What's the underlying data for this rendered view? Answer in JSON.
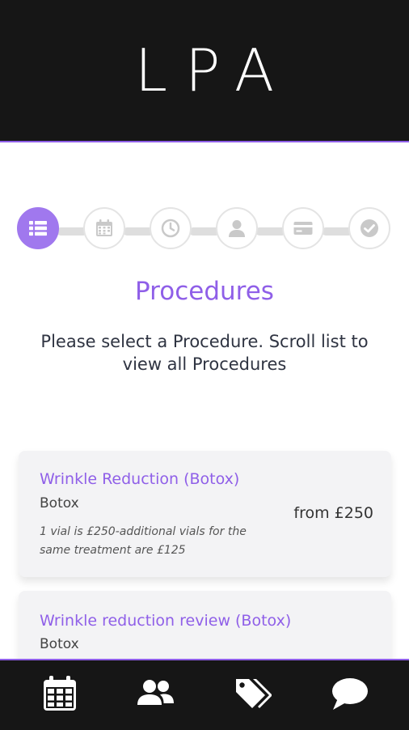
{
  "header": {
    "logo_text": "LPA"
  },
  "stepper": {
    "steps": [
      {
        "name": "procedures",
        "icon": "list-icon",
        "active": true
      },
      {
        "name": "date",
        "icon": "calendar-icon",
        "active": false
      },
      {
        "name": "time",
        "icon": "clock-icon",
        "active": false
      },
      {
        "name": "details",
        "icon": "user-icon",
        "active": false
      },
      {
        "name": "payment",
        "icon": "credit-card-icon",
        "active": false
      },
      {
        "name": "confirm",
        "icon": "check-circle-icon",
        "active": false
      }
    ]
  },
  "main": {
    "title": "Procedures",
    "subtitle": "Please select a Procedure. Scroll list to view all Procedures"
  },
  "procedures": [
    {
      "name": "Wrinkle Reduction (Botox)",
      "category": "Botox",
      "note": "1 vial is £250-additional vials for the same treatment are £125",
      "price": "from £250"
    },
    {
      "name": "Wrinkle reduction review (Botox)",
      "category": "Botox"
    }
  ],
  "tabbar": {
    "tabs": [
      {
        "name": "calendar",
        "icon": "calendar-icon"
      },
      {
        "name": "team",
        "icon": "users-icon"
      },
      {
        "name": "offers",
        "icon": "tags-icon"
      },
      {
        "name": "chat",
        "icon": "chat-bubble-icon"
      }
    ]
  },
  "colors": {
    "accent": "#8f5fe8",
    "header_bg": "#161616",
    "card_bg": "#f3f3f5",
    "step_inactive_icon": "#c9c9c9"
  }
}
